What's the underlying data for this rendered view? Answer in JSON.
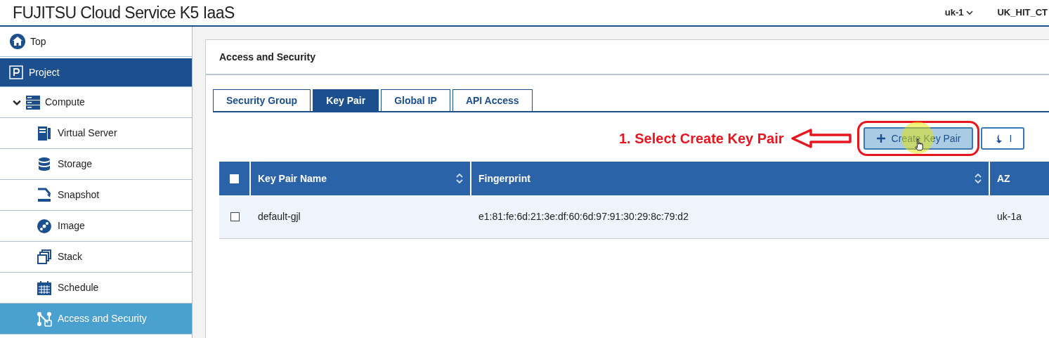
{
  "header": {
    "title": "FUJITSU Cloud Service K5 IaaS",
    "region": "uk-1",
    "project": "UK_HIT_CT"
  },
  "sidebar": {
    "items": [
      {
        "label": "Top",
        "kind": "top"
      },
      {
        "label": "Project",
        "kind": "section"
      },
      {
        "label": "Compute",
        "kind": "group",
        "expanded": true,
        "children": [
          {
            "label": "Virtual Server",
            "selected": false
          },
          {
            "label": "Storage",
            "selected": false
          },
          {
            "label": "Snapshot",
            "selected": false
          },
          {
            "label": "Image",
            "selected": false
          },
          {
            "label": "Stack",
            "selected": false
          },
          {
            "label": "Schedule",
            "selected": false
          },
          {
            "label": "Access and Security",
            "selected": true
          }
        ]
      }
    ]
  },
  "panel": {
    "title": "Access and Security",
    "tabs": [
      {
        "label": "Security Group",
        "selected": false
      },
      {
        "label": "Key Pair",
        "selected": true
      },
      {
        "label": "Global IP",
        "selected": false
      },
      {
        "label": "API Access",
        "selected": false
      }
    ],
    "annotation": "1. Select Create Key Pair",
    "buttons": [
      {
        "label": "Create Key Pair",
        "kind": "create",
        "highlighted": true
      },
      {
        "label": "I",
        "kind": "import",
        "highlighted": false
      }
    ],
    "table": {
      "columns": [
        {
          "label": "Key Pair Name",
          "sortable": true
        },
        {
          "label": "Fingerprint",
          "sortable": true
        },
        {
          "label": "AZ",
          "sortable": false
        }
      ],
      "header_checked": false,
      "rows": [
        {
          "checked": false,
          "cells": [
            "default-gjl",
            "e1:81:fe:6d:21:3e:df:60:6d:97:91:30:29:8c:79:d2",
            "uk-1a"
          ]
        }
      ]
    }
  }
}
